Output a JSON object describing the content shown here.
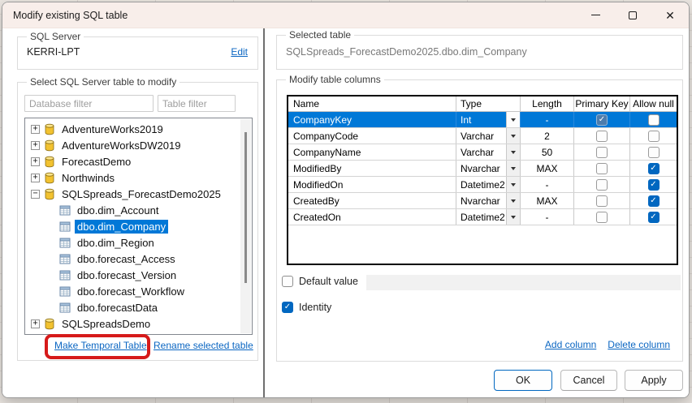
{
  "window": {
    "title": "Modify existing SQL table"
  },
  "left": {
    "server_group": {
      "label": "SQL Server",
      "server_name": "KERRI-LPT",
      "edit_link": "Edit"
    },
    "tree_group": {
      "label": "Select SQL Server table to modify",
      "database_filter_placeholder": "Database filter",
      "table_filter_placeholder": "Table filter",
      "tree": [
        {
          "label": "AdventureWorks2019",
          "icon": "database",
          "level": 0,
          "expander": "+",
          "selected": false
        },
        {
          "label": "AdventureWorksDW2019",
          "icon": "database",
          "level": 0,
          "expander": "+",
          "selected": false
        },
        {
          "label": "ForecastDemo",
          "icon": "database",
          "level": 0,
          "expander": "+",
          "selected": false
        },
        {
          "label": "Northwinds",
          "icon": "database",
          "level": 0,
          "expander": "+",
          "selected": false
        },
        {
          "label": "SQLSpreads_ForecastDemo2025",
          "icon": "database",
          "level": 0,
          "expander": "-",
          "selected": false
        },
        {
          "label": "dbo.dim_Account",
          "icon": "table",
          "level": 1,
          "expander": "",
          "selected": false
        },
        {
          "label": "dbo.dim_Company",
          "icon": "table",
          "level": 1,
          "expander": "",
          "selected": true
        },
        {
          "label": "dbo.dim_Region",
          "icon": "table",
          "level": 1,
          "expander": "",
          "selected": false
        },
        {
          "label": "dbo.forecast_Access",
          "icon": "table",
          "level": 1,
          "expander": "",
          "selected": false
        },
        {
          "label": "dbo.forecast_Version",
          "icon": "table",
          "level": 1,
          "expander": "",
          "selected": false
        },
        {
          "label": "dbo.forecast_Workflow",
          "icon": "table",
          "level": 1,
          "expander": "",
          "selected": false
        },
        {
          "label": "dbo.forecastData",
          "icon": "table",
          "level": 1,
          "expander": "",
          "selected": false
        },
        {
          "label": "SQLSpreadsDemo",
          "icon": "database",
          "level": 0,
          "expander": "+",
          "selected": false
        }
      ],
      "make_temporal_link": "Make Temporal Table",
      "rename_link": "Rename selected table"
    },
    "annotation": {
      "highlight_target": "Make Temporal Table",
      "color": "#d61a1a"
    }
  },
  "right": {
    "selected_table_group": {
      "label": "Selected table",
      "value": "SQLSpreads_ForecastDemo2025.dbo.dim_Company"
    },
    "columns_group": {
      "label": "Modify table columns",
      "table": {
        "headers": [
          "Name",
          "Type",
          "Length",
          "Primary Key",
          "Allow null"
        ],
        "rows": [
          {
            "name": "CompanyKey",
            "type": "Int",
            "length": "-",
            "primary_key": true,
            "allow_null": false,
            "selected": true
          },
          {
            "name": "CompanyCode",
            "type": "Varchar",
            "length": "2",
            "primary_key": false,
            "allow_null": false,
            "selected": false
          },
          {
            "name": "CompanyName",
            "type": "Varchar",
            "length": "50",
            "primary_key": false,
            "allow_null": false,
            "selected": false
          },
          {
            "name": "ModifiedBy",
            "type": "Nvarchar",
            "length": "MAX",
            "primary_key": false,
            "allow_null": true,
            "selected": false
          },
          {
            "name": "ModifiedOn",
            "type": "Datetime2",
            "length": "-",
            "primary_key": false,
            "allow_null": true,
            "selected": false
          },
          {
            "name": "CreatedBy",
            "type": "Nvarchar",
            "length": "MAX",
            "primary_key": false,
            "allow_null": true,
            "selected": false
          },
          {
            "name": "CreatedOn",
            "type": "Datetime2",
            "length": "-",
            "primary_key": false,
            "allow_null": true,
            "selected": false
          }
        ]
      },
      "default_value_label": "Default value",
      "default_value_checked": false,
      "default_value_text": "",
      "identity_label": "Identity",
      "identity_checked": true,
      "add_column_link": "Add column",
      "delete_column_link": "Delete column"
    },
    "buttons": {
      "ok": "OK",
      "cancel": "Cancel",
      "apply": "Apply"
    }
  },
  "colors": {
    "selection_blue": "#0078d7",
    "checkbox_blue": "#0067c0",
    "link_blue": "#0b66c2",
    "titlebar": "#f8eeea",
    "annotation_red": "#d61a1a"
  }
}
